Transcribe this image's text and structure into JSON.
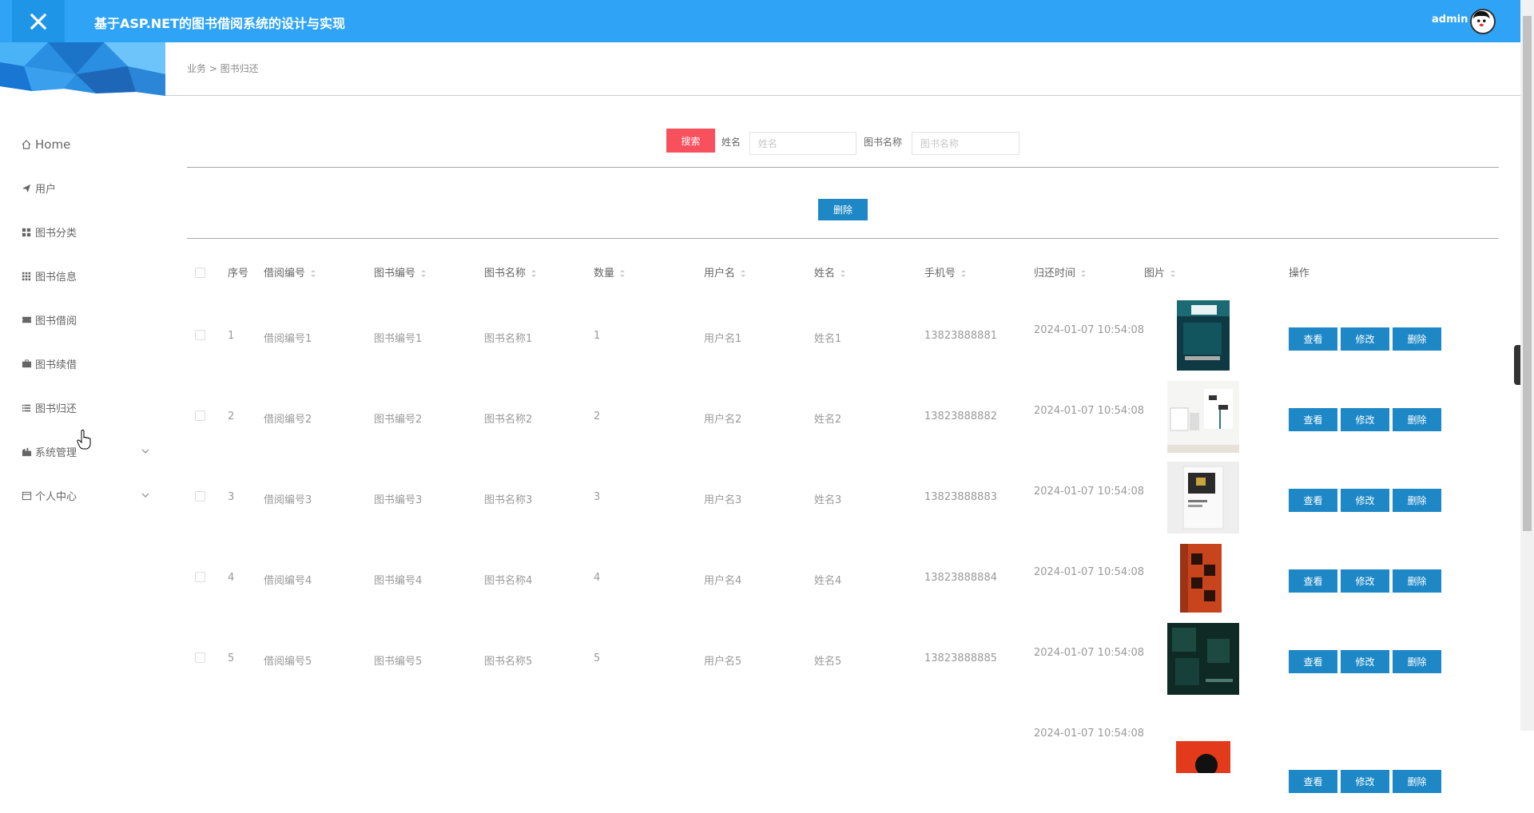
{
  "header": {
    "title": "基于ASP.NET的图书借阅系统的设计与实现",
    "user": "admin"
  },
  "sidebar": {
    "items": [
      {
        "label": "Home",
        "icon": "home-icon"
      },
      {
        "label": "用户",
        "icon": "paper-plane-icon"
      },
      {
        "label": "图书分类",
        "icon": "grid-icon"
      },
      {
        "label": "图书信息",
        "icon": "grid-9-icon"
      },
      {
        "label": "图书借阅",
        "icon": "ticket-icon"
      },
      {
        "label": "图书续借",
        "icon": "briefcase-icon"
      },
      {
        "label": "图书归还",
        "icon": "list-icon"
      },
      {
        "label": "系统管理",
        "icon": "building-icon"
      },
      {
        "label": "个人中心",
        "icon": "calendar-icon"
      }
    ]
  },
  "breadcrumb": "业务 > 图书归还",
  "search": {
    "button": "搜索",
    "name_label": "姓名",
    "name_placeholder": "姓名",
    "book_label": "图书名称",
    "book_placeholder": "图书名称"
  },
  "toolbar": {
    "delete_label": "删除"
  },
  "table": {
    "headers": [
      "序号",
      "借阅编号",
      "图书编号",
      "图书名称",
      "数量",
      "用户名",
      "姓名",
      "手机号",
      "归还时间",
      "图片",
      "操作"
    ],
    "rows": [
      {
        "no": "1",
        "borrow_id": "借阅编号1",
        "book_id": "图书编号1",
        "book_name": "图书名称1",
        "qty": "1",
        "username": "用户名1",
        "name": "姓名1",
        "phone": "13823888881",
        "time": "2024-01-07 10:54:08"
      },
      {
        "no": "2",
        "borrow_id": "借阅编号2",
        "book_id": "图书编号2",
        "book_name": "图书名称2",
        "qty": "2",
        "username": "用户名2",
        "name": "姓名2",
        "phone": "13823888882",
        "time": "2024-01-07 10:54:08"
      },
      {
        "no": "3",
        "borrow_id": "借阅编号3",
        "book_id": "图书编号3",
        "book_name": "图书名称3",
        "qty": "3",
        "username": "用户名3",
        "name": "姓名3",
        "phone": "13823888883",
        "time": "2024-01-07 10:54:08"
      },
      {
        "no": "4",
        "borrow_id": "借阅编号4",
        "book_id": "图书编号4",
        "book_name": "图书名称4",
        "qty": "4",
        "username": "用户名4",
        "name": "姓名4",
        "phone": "13823888884",
        "time": "2024-01-07 10:54:08"
      },
      {
        "no": "5",
        "borrow_id": "借阅编号5",
        "book_id": "图书编号5",
        "book_name": "图书名称5",
        "qty": "5",
        "username": "用户名5",
        "name": "姓名5",
        "phone": "13823888885",
        "time": "2024-01-07 10:54:08"
      },
      {
        "time": "2024-01-07 10:54:08"
      }
    ],
    "actions": {
      "view": "查看",
      "edit": "修改",
      "delete": "删除"
    }
  },
  "colors": {
    "topbar": "#2fa4f6",
    "primary_button": "#1e88c7",
    "search_button": "#f8505c"
  }
}
